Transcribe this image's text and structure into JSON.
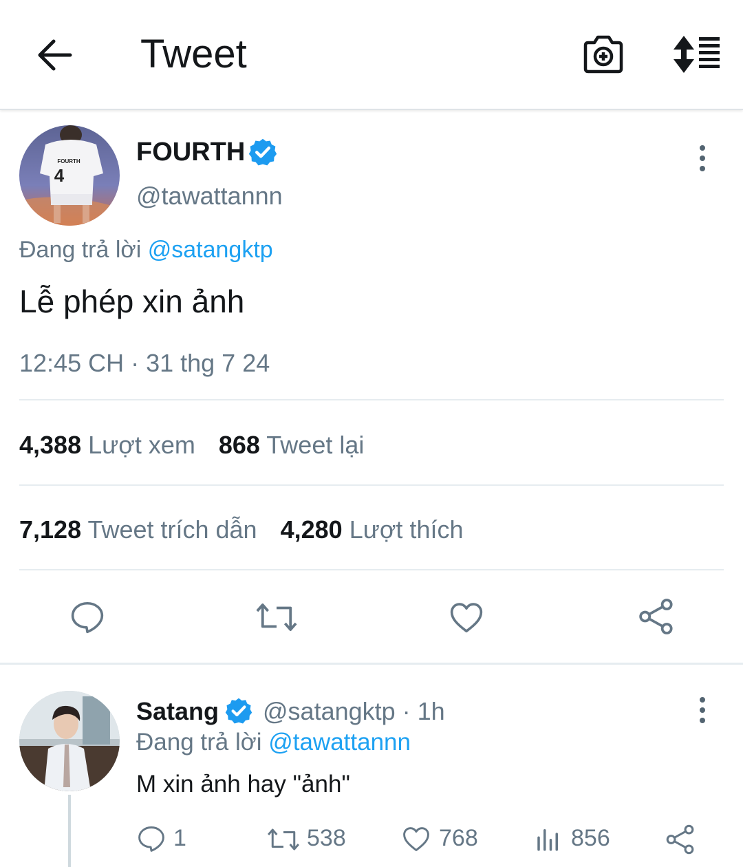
{
  "header": {
    "title": "Tweet",
    "back_icon": "arrow-left-icon",
    "camera_icon": "camera-plus-icon",
    "sort_icon": "sort-list-icon"
  },
  "tweet": {
    "author_name": "FOURTH",
    "author_handle": "@tawattannn",
    "verified": true,
    "replying_prefix": "Đang trả lời",
    "replying_to": "@satangktp",
    "text": "Lễ phép xin ảnh",
    "timestamp": "12:45 CH · 31 thg 7 24",
    "stats": {
      "views_value": "4,388",
      "views_label": "Lượt xem",
      "retweets_value": "868",
      "retweets_label": "Tweet lại",
      "quotes_value": "7,128",
      "quotes_label": "Tweet trích dẫn",
      "likes_value": "4,280",
      "likes_label": "Lượt thích"
    },
    "avatar_jersey_text": "FOURTH",
    "avatar_jersey_number": "4"
  },
  "reply": {
    "author_name": "Satang",
    "author_handle": "@satangktp",
    "time": "· 1h",
    "replying_prefix": "Đang trả lời",
    "replying_to": "@tawattannn",
    "text": "M xin ảnh hay \"ảnh\"",
    "counts": {
      "replies": "1",
      "retweets": "538",
      "likes": "768",
      "views": "856"
    }
  },
  "colors": {
    "accent": "#1da1f2",
    "text": "#14171a",
    "muted": "#657786",
    "divider": "#e6ecf0"
  }
}
